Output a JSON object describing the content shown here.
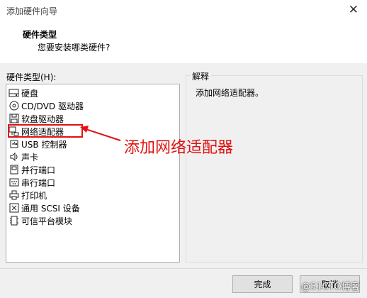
{
  "window": {
    "title": "添加硬件向导",
    "close_symbol": "✕"
  },
  "header": {
    "title": "硬件类型",
    "subtitle": "您要安装哪类硬件?"
  },
  "hardware_list": {
    "label": "硬件类型(H):",
    "items": [
      {
        "label": "硬盘",
        "icon": "hard-disk-icon"
      },
      {
        "label": "CD/DVD 驱动器",
        "icon": "cd-dvd-icon"
      },
      {
        "label": "软盘驱动器",
        "icon": "floppy-icon"
      },
      {
        "label": "网络适配器",
        "icon": "network-adapter-icon"
      },
      {
        "label": "USB 控制器",
        "icon": "usb-icon"
      },
      {
        "label": "声卡",
        "icon": "speaker-icon"
      },
      {
        "label": "并行端口",
        "icon": "parallel-port-icon"
      },
      {
        "label": "串行端口",
        "icon": "serial-port-icon"
      },
      {
        "label": "打印机",
        "icon": "printer-icon"
      },
      {
        "label": "通用 SCSI 设备",
        "icon": "scsi-icon"
      },
      {
        "label": "可信平台模块",
        "icon": "tpm-icon"
      }
    ]
  },
  "explanation": {
    "legend": "解释",
    "text": "添加网络适配器。"
  },
  "annotation": {
    "text": "添加网络适配器",
    "color": "#e21010"
  },
  "buttons": {
    "finish": "完成",
    "cancel": "取消"
  },
  "watermark": "@51CTO博客"
}
